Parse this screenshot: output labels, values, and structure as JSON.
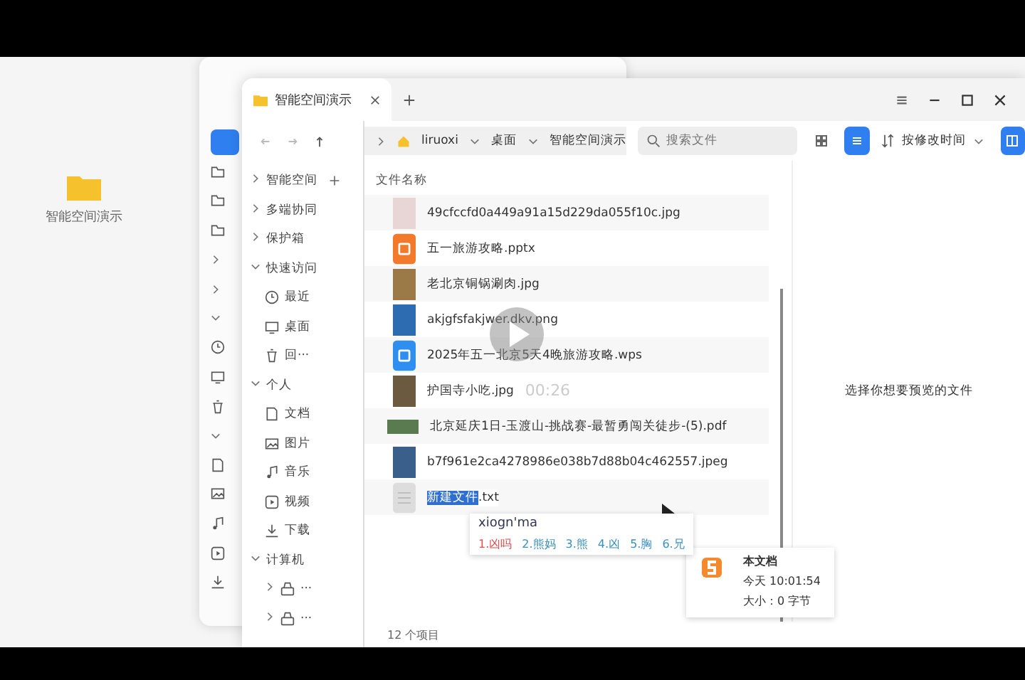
{
  "desktop": {
    "icon_label": "智能空间演示"
  },
  "back_window": {
    "rows": [
      {
        "kind": "highlight"
      },
      {
        "kind": "folder"
      },
      {
        "kind": "folder"
      },
      {
        "kind": "folder"
      },
      {
        "kind": "chevron"
      },
      {
        "kind": "chevron"
      },
      {
        "kind": "open"
      },
      {
        "kind": "clock"
      },
      {
        "kind": "monitor"
      },
      {
        "kind": "trash"
      },
      {
        "kind": "open"
      },
      {
        "kind": "doc"
      },
      {
        "kind": "picture"
      },
      {
        "kind": "music"
      },
      {
        "kind": "video"
      },
      {
        "kind": "download"
      }
    ]
  },
  "window": {
    "tab": {
      "title": "智能空间演示"
    },
    "breadcrumb": [
      "liruoxi",
      "桌面",
      "智能空间演示"
    ],
    "search": {
      "placeholder": "搜索文件"
    },
    "view_modes": [
      {
        "kind": "icons",
        "selected": false
      },
      {
        "kind": "list",
        "selected": true
      }
    ],
    "sort": {
      "label": "按修改时间"
    },
    "preview_panel": {
      "on": true
    },
    "sidebar": [
      {
        "label": "智能空间",
        "expanded": false,
        "add": true
      },
      {
        "label": "多端协同",
        "expanded": false
      },
      {
        "label": "保护箱",
        "expanded": false
      },
      {
        "label": "快速访问",
        "expanded": true,
        "children": [
          {
            "label": "最近",
            "kind": "clock"
          },
          {
            "label": "桌面",
            "kind": "monitor"
          },
          {
            "label": "回···",
            "kind": "trash"
          }
        ]
      },
      {
        "label": "个人",
        "expanded": true,
        "children": [
          {
            "label": "文档",
            "kind": "doc"
          },
          {
            "label": "图片",
            "kind": "picture"
          },
          {
            "label": "音乐",
            "kind": "music"
          },
          {
            "label": "视频",
            "kind": "video"
          },
          {
            "label": "下载",
            "kind": "download"
          }
        ]
      },
      {
        "label": "计算机",
        "expanded": true,
        "children": [
          {
            "label": "···",
            "kind": "drive",
            "expanded": false
          },
          {
            "label": "···",
            "kind": "drive",
            "expanded": false
          }
        ]
      }
    ],
    "column_header": "文件名称",
    "files": [
      {
        "name": "49cfccfd0a449a91a15d229da055f10c.jpg",
        "kind": "image",
        "color": "#e8d6d6"
      },
      {
        "name": "五一旅游攻略.pptx",
        "kind": "pptx",
        "color": "#f27a2a"
      },
      {
        "name": "老北京铜锅涮肉.jpg",
        "kind": "image",
        "color": "#9c7a48"
      },
      {
        "name": "akjgfsfakjwer.dkv.png",
        "kind": "image",
        "color": "#2d6cb0"
      },
      {
        "name": "2025年五一北京5天4晚旅游攻略.wps",
        "kind": "wps",
        "color": "#2f8ff0"
      },
      {
        "name": "护国寺小吃.jpg",
        "kind": "image",
        "color": "#6b5a40"
      },
      {
        "name": "北京延庆1日-玉渡山-挑战赛-最暂勇闯关徒步-(5).pdf",
        "kind": "wide-image",
        "color": "#5a7a50"
      },
      {
        "name": "b7f961e2ca4278986e038b7d88b04c462557.jpeg",
        "kind": "image",
        "color": "#3a5f8a"
      },
      {
        "name": "新建文件",
        "name_suffix": ".txt",
        "kind": "blank",
        "color": "#dddddd",
        "renaming": true
      }
    ],
    "ime": {
      "input": "xiogn'ma",
      "candidates": [
        {
          "text": "1.凶吗",
          "selected": true
        },
        {
          "text": "2.熊妈",
          "selected": false
        },
        {
          "text": "3.熊",
          "selected": false
        },
        {
          "text": "4.凶",
          "selected": false
        },
        {
          "text": "5.胸",
          "selected": false
        },
        {
          "text": "6.兄",
          "selected": false
        }
      ]
    },
    "tooltip": {
      "title": "本文档",
      "lines": [
        "今天 10:01:54",
        "大小：0 字节"
      ]
    },
    "preview_hint": "选择你想要预览的文件",
    "status": "12 个项目"
  },
  "video": {
    "timestamp": "00:26"
  }
}
